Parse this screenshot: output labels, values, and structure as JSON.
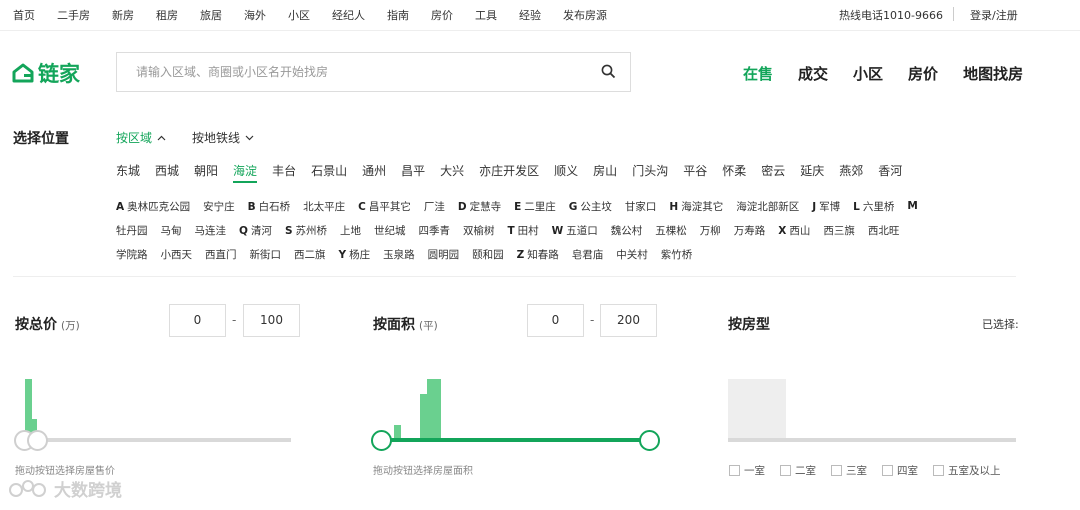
{
  "topnav": {
    "items": [
      "首页",
      "二手房",
      "新房",
      "租房",
      "旅居",
      "海外",
      "小区",
      "经纪人",
      "指南",
      "房价",
      "工具",
      "经验",
      "发布房源"
    ],
    "hotline": "热线电话1010-9666",
    "login": "登录/注册"
  },
  "logo": {
    "text": "链家",
    "icon": "house-logo-icon"
  },
  "search": {
    "placeholder": "请输入区域、商圈或小区名开始找房",
    "icon": "search-icon"
  },
  "mainnav": [
    {
      "label": "在售",
      "active": true
    },
    {
      "label": "成交",
      "active": false
    },
    {
      "label": "小区",
      "active": false
    },
    {
      "label": "房价",
      "active": false
    },
    {
      "label": "地图找房",
      "active": false
    }
  ],
  "location": {
    "title": "选择位置",
    "tabs": [
      {
        "label": "按区域",
        "active": true,
        "icon": "chevron-up-icon"
      },
      {
        "label": "按地铁线",
        "active": false,
        "icon": "chevron-down-icon"
      }
    ],
    "districts": [
      "东城",
      "西城",
      "朝阳",
      "海淀",
      "丰台",
      "石景山",
      "通州",
      "昌平",
      "大兴",
      "亦庄开发区",
      "顺义",
      "房山",
      "门头沟",
      "平谷",
      "怀柔",
      "密云",
      "延庆",
      "燕郊",
      "香河"
    ],
    "active_district": "海淀",
    "biz_rows": [
      [
        {
          "letter": "A",
          "name": "奥林匹克公园"
        },
        {
          "letter": "",
          "name": "安宁庄"
        },
        {
          "letter": "B",
          "name": "白石桥"
        },
        {
          "letter": "",
          "name": "北太平庄"
        },
        {
          "letter": "C",
          "name": "昌平其它"
        },
        {
          "letter": "",
          "name": "厂洼"
        },
        {
          "letter": "D",
          "name": "定慧寺"
        },
        {
          "letter": "E",
          "name": "二里庄"
        },
        {
          "letter": "G",
          "name": "公主坟"
        },
        {
          "letter": "",
          "name": "甘家口"
        },
        {
          "letter": "H",
          "name": "海淀其它"
        },
        {
          "letter": "",
          "name": "海淀北部新区"
        },
        {
          "letter": "J",
          "name": "军博"
        },
        {
          "letter": "L",
          "name": "六里桥"
        },
        {
          "letter": "M",
          "name": ""
        }
      ],
      [
        {
          "letter": "",
          "name": "牡丹园"
        },
        {
          "letter": "",
          "name": "马甸"
        },
        {
          "letter": "",
          "name": "马连洼"
        },
        {
          "letter": "Q",
          "name": "清河"
        },
        {
          "letter": "S",
          "name": "苏州桥"
        },
        {
          "letter": "",
          "name": "上地"
        },
        {
          "letter": "",
          "name": "世纪城"
        },
        {
          "letter": "",
          "name": "四季青"
        },
        {
          "letter": "",
          "name": "双榆树"
        },
        {
          "letter": "T",
          "name": "田村"
        },
        {
          "letter": "W",
          "name": "五道口"
        },
        {
          "letter": "",
          "name": "魏公村"
        },
        {
          "letter": "",
          "name": "五棵松"
        },
        {
          "letter": "",
          "name": "万柳"
        },
        {
          "letter": "",
          "name": "万寿路"
        },
        {
          "letter": "X",
          "name": "西山"
        },
        {
          "letter": "",
          "name": "西三旗"
        },
        {
          "letter": "",
          "name": "西北旺"
        }
      ],
      [
        {
          "letter": "",
          "name": "学院路"
        },
        {
          "letter": "",
          "name": "小西天"
        },
        {
          "letter": "",
          "name": "西直门"
        },
        {
          "letter": "",
          "name": "新街口"
        },
        {
          "letter": "",
          "name": "西二旗"
        },
        {
          "letter": "Y",
          "name": "杨庄"
        },
        {
          "letter": "",
          "name": "玉泉路"
        },
        {
          "letter": "",
          "name": "圆明园"
        },
        {
          "letter": "",
          "name": "颐和园"
        },
        {
          "letter": "Z",
          "name": "知春路"
        },
        {
          "letter": "",
          "name": "皂君庙"
        },
        {
          "letter": "",
          "name": "中关村"
        },
        {
          "letter": "",
          "name": "紫竹桥"
        }
      ]
    ]
  },
  "price_filter": {
    "title": "按总价",
    "unit": "(万)",
    "min": "0",
    "max": "100",
    "dash": "-",
    "hint": "拖动按钮选择房屋售价"
  },
  "area_filter": {
    "title": "按面积",
    "unit": "(平)",
    "min": "0",
    "max": "200",
    "dash": "-",
    "hint": "拖动按钮选择房屋面积"
  },
  "room_filter": {
    "title": "按房型",
    "selected_label": "已选择:",
    "options": [
      "一室",
      "二室",
      "三室",
      "四室",
      "五室及以上"
    ]
  },
  "watermark": {
    "text": "大数跨境",
    "icon": "watermark-logo-icon"
  },
  "colors": {
    "brand": "#13a55a",
    "bar": "#6ad08f"
  }
}
